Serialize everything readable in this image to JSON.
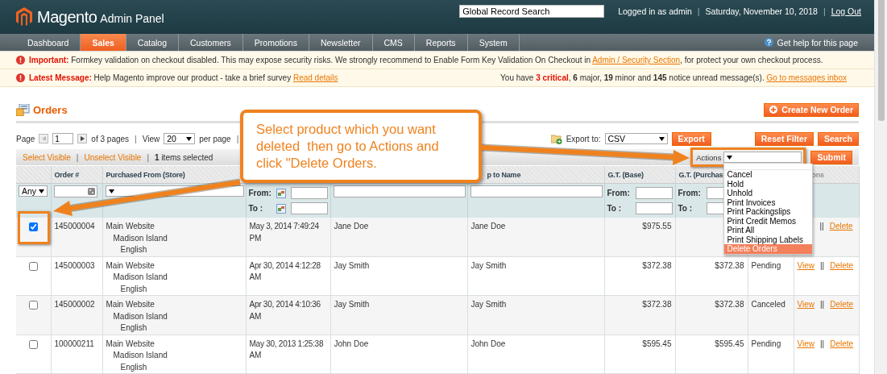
{
  "header": {
    "logo": "Magento",
    "logo_suffix": "Admin Panel",
    "search_value": "Global Record Search",
    "user": "Logged in as admin",
    "sep_1": "|",
    "date": "Saturday, November 10, 2018",
    "sep_2": "|",
    "logout": "Log Out"
  },
  "nav": {
    "items": [
      {
        "label": "Dashboard",
        "selected": false
      },
      {
        "label": "Sales",
        "selected": true
      },
      {
        "label": "Catalog",
        "selected": false
      },
      {
        "label": "Customers",
        "selected": false
      },
      {
        "label": "Promotions",
        "selected": false
      },
      {
        "label": "Newsletter",
        "selected": false
      },
      {
        "label": "CMS",
        "selected": false
      },
      {
        "label": "Reports",
        "selected": false
      },
      {
        "label": "System",
        "selected": false
      }
    ],
    "help": "Get help for this page"
  },
  "messages": [
    {
      "kind": "important",
      "label": "Important:",
      "text": "Formkey validation on checkout disabled. This may expose security risks. We strongly recommend to Enable Form Key Validation On Checkout in",
      "link": "Admin / Security Section",
      "text_after": ", for protect your own checkout process."
    },
    {
      "kind": "latest",
      "label": "Latest Message:",
      "text": "Help Magento improve our product - take a brief survey",
      "link": "Read details",
      "summary": "You have **3 critical**, **6** major, **19** minor and **145** notice unread message(s).",
      "summary_link": "Go to messages inbox"
    }
  ],
  "page": {
    "title": "Orders",
    "create_button": "Create New Order"
  },
  "pager": {
    "page_label": "Page",
    "page_value": "1",
    "pages_text": "of 3 pages",
    "sep_1": "|",
    "view_label": "View",
    "per_page_value": "20",
    "per_page_label": "per page",
    "sep_2": "|",
    "export_label": "Export to:",
    "export_value": "CSV",
    "export_button": "Export",
    "reset_button": "Reset Filter",
    "search_button": "Search"
  },
  "massaction": {
    "select_visible": "Select Visible",
    "sep_1": "|",
    "unselect_visible": "Unselect Visible",
    "sep_2": "|",
    "selected_text": "**1** items selected",
    "actions_label": "Actions",
    "highlighted": true,
    "submit_button": "Submit",
    "options": [
      {
        "label": "Cancel",
        "selected": false
      },
      {
        "label": "Hold",
        "selected": false
      },
      {
        "label": "Unhold",
        "selected": false
      },
      {
        "label": "Print Invoices",
        "selected": false
      },
      {
        "label": "Print Packingslips",
        "selected": false
      },
      {
        "label": "Print Credit Memos",
        "selected": false
      },
      {
        "label": "Print All",
        "selected": false
      },
      {
        "label": "Print Shipping Labels",
        "selected": false
      },
      {
        "label": "Delete Orders",
        "selected": true
      }
    ]
  },
  "table": {
    "headers": {
      "order": "Order #",
      "store": "Purchased From (Store)",
      "ship_to": "p to Name",
      "gt_base": "G.T. (Base)",
      "gt_purchased": "G.T. (Purchas",
      "actions": "ons"
    },
    "filters": {
      "visibility": "Any",
      "from_label": "From:",
      "to_label": "To :",
      "gt_base_from": "From:",
      "gt_base_to": "To :",
      "gt_purchased_from": "From:",
      "gt_purchased_to": "To :"
    },
    "rows": [
      {
        "checked": true,
        "highlighted": true,
        "order": "145000004",
        "website": "Main Website",
        "store": "Madison Island",
        "store_view": "English",
        "purchased_on": "May 3, 2014 7:49:24 PM",
        "bill_to": "Jane Doe",
        "ship_to": "Jane Doe",
        "gt_base": "$975.55",
        "separator": "||",
        "delete_link": "Delete"
      },
      {
        "checked": false,
        "highlighted": false,
        "order": "145000003",
        "website": "Main Website",
        "store": "Madison Island",
        "store_view": "English",
        "purchased_on": "Apr 30, 2014 4:12:28 AM",
        "bill_to": "Jay Smith",
        "ship_to": "Jay Smith",
        "gt_base": "$372.38",
        "gt_purchased": "$372.38",
        "status": "Pending",
        "view_link": "View",
        "separator": "||",
        "delete_link": "Delete"
      },
      {
        "checked": false,
        "highlighted": false,
        "order": "145000002",
        "website": "Main Website",
        "store": "Madison Island",
        "store_view": "English",
        "purchased_on": "Apr 30, 2014 4:10:36 AM",
        "bill_to": "Jay Smith",
        "ship_to": "Jay Smith",
        "gt_base": "$372.38",
        "gt_purchased": "$372.38",
        "status": "Canceled",
        "view_link": "View",
        "separator": "||",
        "delete_link": "Delete"
      },
      {
        "checked": false,
        "highlighted": false,
        "order": "100000211",
        "website": "Main Website",
        "store": "Madison Island",
        "store_view": "English",
        "purchased_on": "May 30, 2013 1:25:38 AM",
        "bill_to": "John Doe",
        "ship_to": "John Doe",
        "gt_base": "$595.45",
        "gt_purchased": "$595.45",
        "status": "Pending",
        "view_link": "View",
        "separator": "||",
        "delete_link": "Delete"
      }
    ]
  },
  "callout": {
    "text": "Select product which you want deleted  then go to Actions and click \"Delete Orders."
  }
}
